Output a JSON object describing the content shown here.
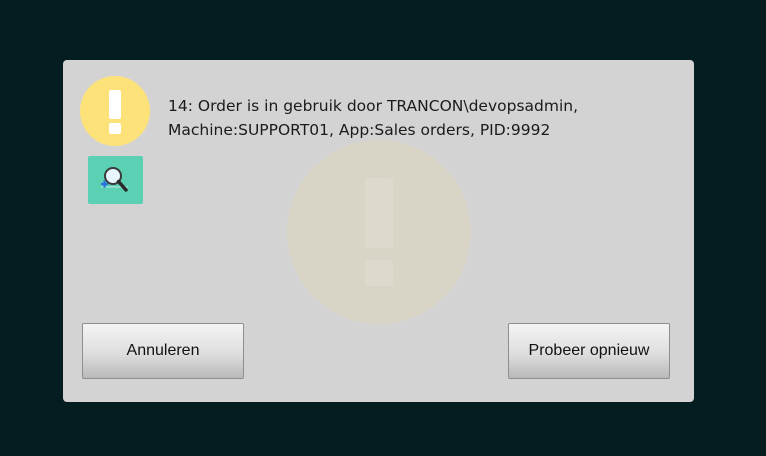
{
  "dialog": {
    "icon": "warning-icon",
    "zoom_icon": "magnifier-icon",
    "message_lines": [
      "14: Order is in gebruik door TRANCON\\devopsadmin,",
      "Machine:SUPPORT01, App:Sales orders, PID:9992"
    ],
    "cancel_label": "Annuleren",
    "retry_label": "Probeer opnieuw"
  },
  "colors": {
    "background": "#031d20",
    "dialog": "#d3d3d3",
    "warning": "#fde27a",
    "zoom_button": "#5bd0b3"
  }
}
